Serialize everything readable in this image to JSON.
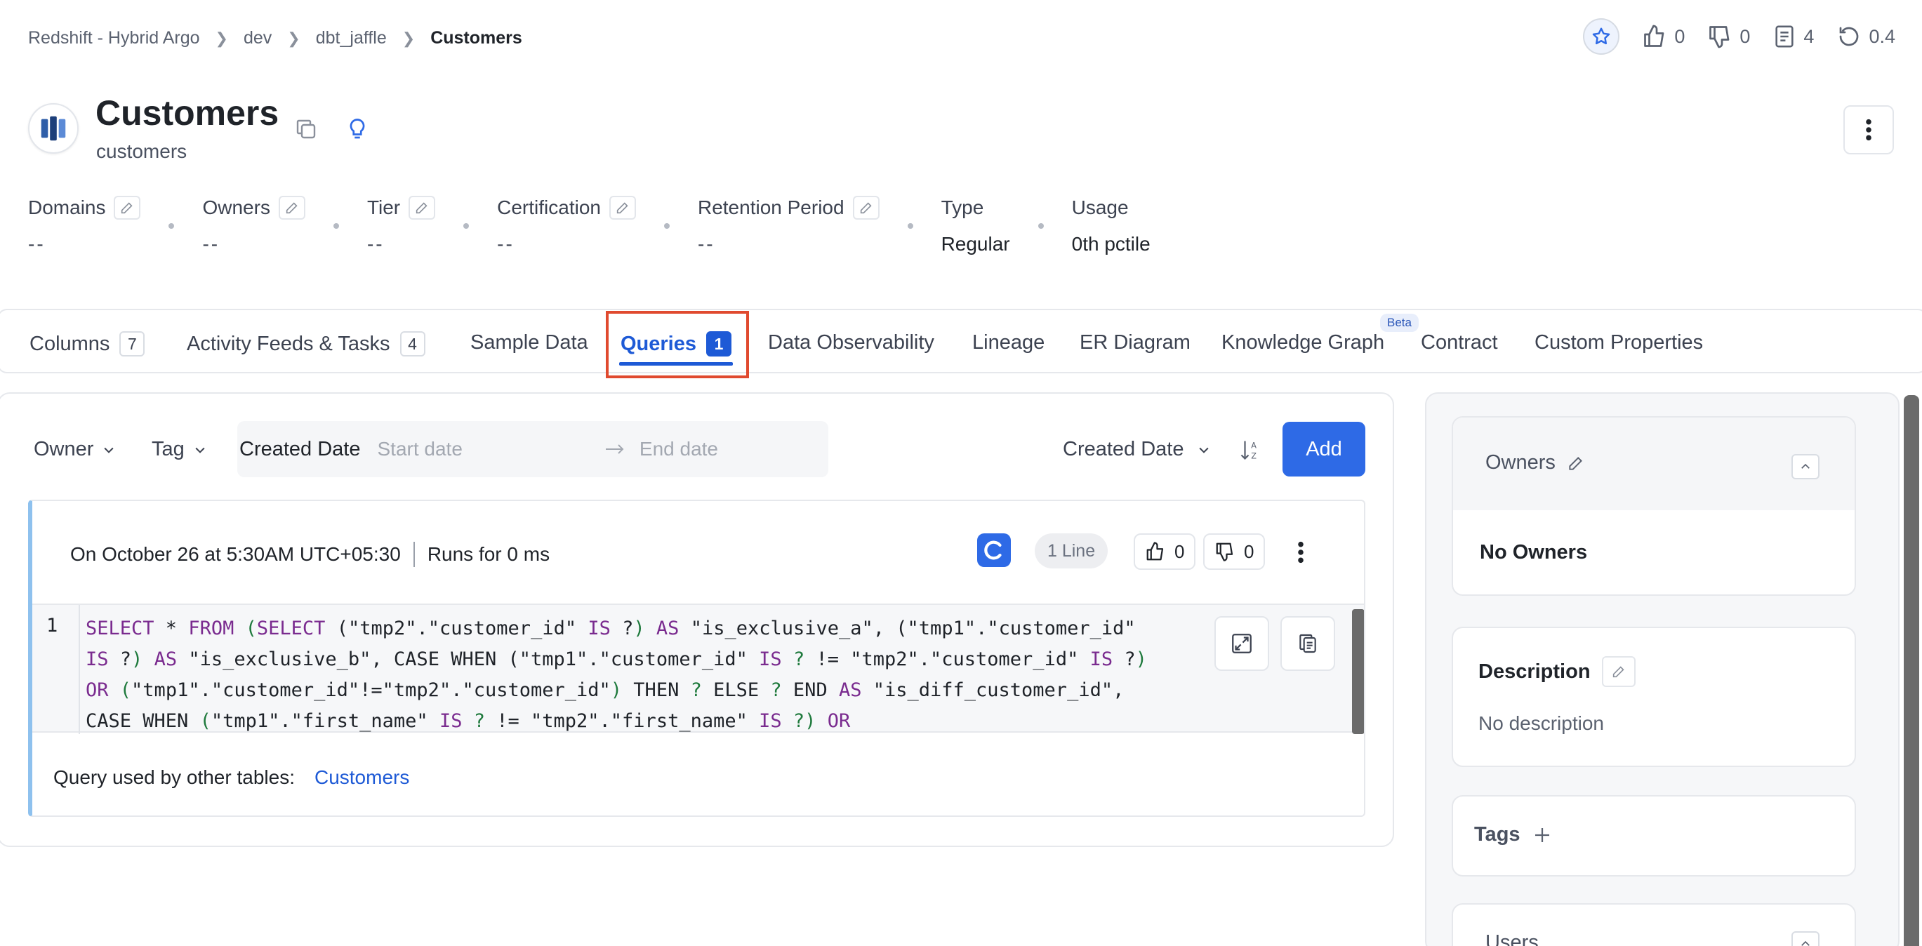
{
  "breadcrumb": [
    "Redshift - Hybrid Argo",
    "dev",
    "dbt_jaffle"
  ],
  "breadcrumb_current": "Customers",
  "top_actions": {
    "likes": "0",
    "dislikes": "0",
    "tasks": "4",
    "version": "0.4"
  },
  "entity": {
    "title": "Customers",
    "subtitle": "customers"
  },
  "props": {
    "domains": {
      "label": "Domains",
      "value": "--"
    },
    "owners": {
      "label": "Owners",
      "value": "--"
    },
    "tier": {
      "label": "Tier",
      "value": "--"
    },
    "certification": {
      "label": "Certification",
      "value": "--"
    },
    "retention": {
      "label": "Retention Period",
      "value": "--"
    },
    "type": {
      "label": "Type",
      "value": "Regular"
    },
    "usage": {
      "label": "Usage",
      "value": "0th pctile"
    }
  },
  "tabs": [
    {
      "label": "Columns",
      "count": "7"
    },
    {
      "label": "Activity Feeds & Tasks",
      "count": "4"
    },
    {
      "label": "Sample Data"
    },
    {
      "label": "Queries",
      "count": "1"
    },
    {
      "label": "Data Observability"
    },
    {
      "label": "Lineage"
    },
    {
      "label": "ER Diagram"
    },
    {
      "label": "Knowledge Graph"
    },
    {
      "label": "Contract"
    },
    {
      "label": "Custom Properties"
    }
  ],
  "beta_badge": "Beta",
  "filters": {
    "owner": "Owner",
    "tag": "Tag",
    "created_date": "Created Date",
    "start_placeholder": "Start date",
    "end_placeholder": "End date",
    "sort_by": "Created Date",
    "add": "Add"
  },
  "query": {
    "date": "On October 26 at 5:30AM UTC+05:30",
    "runs": "Runs for 0 ms",
    "lines": "1 Line",
    "likes": "0",
    "dislikes": "0",
    "line_number": "1",
    "used_by_label": "Query used by other tables:",
    "used_by_link": "Customers"
  },
  "right_panel": {
    "owners_title": "Owners",
    "no_owners": "No Owners",
    "description_title": "Description",
    "no_description": "No description",
    "tags_title": "Tags",
    "users_title": "Users"
  },
  "colors": {
    "accent": "#2e6ae6",
    "highlight": "#e04a2f",
    "query_border": "#8ec1ee"
  }
}
